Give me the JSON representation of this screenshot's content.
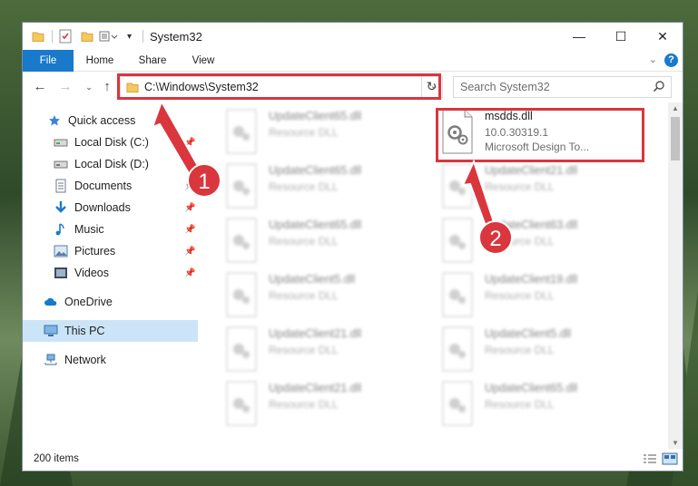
{
  "window": {
    "title": "System32",
    "controls": {
      "minimize": "—",
      "maximize": "☐",
      "close": "✕"
    }
  },
  "ribbon": {
    "tabs": [
      "File",
      "Home",
      "Share",
      "View"
    ],
    "help": "?"
  },
  "address": {
    "path": "C:\\Windows\\System32",
    "search_placeholder": "Search System32"
  },
  "nav": {
    "items": [
      {
        "label": "Quick access",
        "icon": "star-icon",
        "pinned": false
      },
      {
        "label": "Local Disk (C:)",
        "icon": "drive-icon",
        "pinned": true
      },
      {
        "label": "Local Disk (D:)",
        "icon": "drive-icon",
        "pinned": true
      },
      {
        "label": "Documents",
        "icon": "documents-icon",
        "pinned": true
      },
      {
        "label": "Downloads",
        "icon": "download-icon",
        "pinned": true
      },
      {
        "label": "Music",
        "icon": "music-icon",
        "pinned": true
      },
      {
        "label": "Pictures",
        "icon": "pictures-icon",
        "pinned": true
      },
      {
        "label": "Videos",
        "icon": "videos-icon",
        "pinned": true
      },
      {
        "label": "OneDrive",
        "icon": "cloud-icon",
        "pinned": false
      },
      {
        "label": "This PC",
        "icon": "computer-icon",
        "pinned": false,
        "selected": true
      },
      {
        "label": "Network",
        "icon": "network-icon",
        "pinned": false
      }
    ]
  },
  "files": {
    "highlighted": {
      "name": "msdds.dll",
      "version": "10.0.30319.1",
      "description": "Microsoft Design To..."
    },
    "left_column": [
      {
        "name": "UpdateClient65.dll",
        "type": "Resource DLL"
      },
      {
        "name": "UpdateClient65.dll",
        "type": "Resource DLL"
      },
      {
        "name": "UpdateClient65.dll",
        "type": "Resource DLL"
      },
      {
        "name": "UpdateClient5.dll",
        "type": "Resource DLL"
      },
      {
        "name": "UpdateClient21.dll",
        "type": "Resource DLL"
      },
      {
        "name": "UpdateClient21.dll",
        "type": "Resource DLL"
      }
    ],
    "right_column": [
      {
        "name": "UpdateClient21.dll",
        "type": "Resource DLL"
      },
      {
        "name": "UpdateClient63.dll",
        "type": "Resource DLL"
      },
      {
        "name": "UpdateClient19.dll",
        "type": "Resource DLL"
      },
      {
        "name": "UpdateClient5.dll",
        "type": "Resource DLL"
      },
      {
        "name": "UpdateClient65.dll",
        "type": "Resource DLL"
      }
    ]
  },
  "status": {
    "item_count": "200 items"
  },
  "annotations": {
    "step1": "1",
    "step2": "2",
    "color": "#d9363e"
  }
}
